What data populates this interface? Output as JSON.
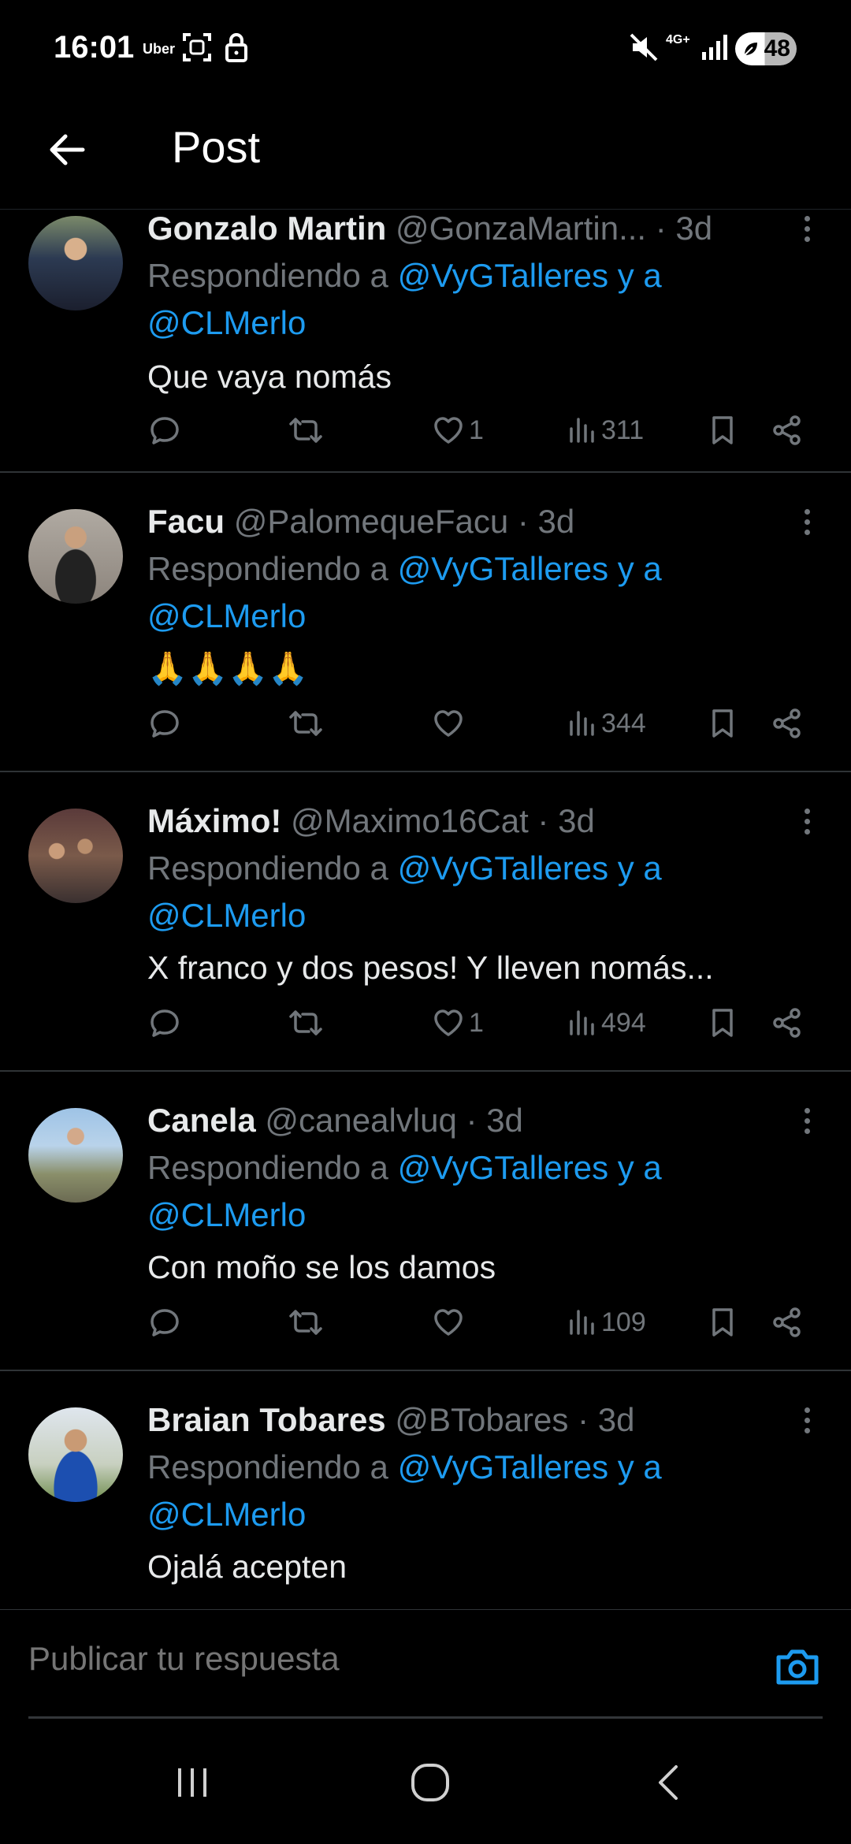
{
  "status": {
    "time": "16:01",
    "app": "Uber",
    "network": "4G+",
    "battery": "48"
  },
  "header": {
    "title": "Post"
  },
  "posts": [
    {
      "name": "Gonzalo Martin",
      "handle": "@GonzaMartin...",
      "dot": " · ",
      "time": "3d",
      "reply_prefix": "Respondiendo a ",
      "reply_links": "@VyGTalleres y a",
      "reply_link2": "@CLMerlo",
      "text": "Que vaya nomás",
      "likes": "1",
      "views": "311"
    },
    {
      "name": "Facu",
      "handle": "@PalomequeFacu",
      "dot": " · ",
      "time": "3d",
      "reply_prefix": "Respondiendo a ",
      "reply_links": "@VyGTalleres y a",
      "reply_link2": "@CLMerlo",
      "text": "🙏🙏🙏🙏",
      "likes": "",
      "views": "344"
    },
    {
      "name": "Máximo!",
      "handle": "@Maximo16Cat",
      "dot": " · ",
      "time": "3d",
      "reply_prefix": "Respondiendo a ",
      "reply_links": "@VyGTalleres y a",
      "reply_link2": "@CLMerlo",
      "text": "X franco y dos pesos! Y lleven nomás...",
      "likes": "1",
      "views": "494"
    },
    {
      "name": "Canela",
      "handle": "@canealvluq",
      "dot": " · ",
      "time": "3d",
      "reply_prefix": "Respondiendo a ",
      "reply_links": "@VyGTalleres y a",
      "reply_link2": "@CLMerlo",
      "text": "Con moño se los damos",
      "likes": "",
      "views": "109"
    },
    {
      "name": "Braian Tobares",
      "handle": "@BTobares",
      "dot": " · ",
      "time": "3d",
      "reply_prefix": "Respondiendo a ",
      "reply_links": "@VyGTalleres y a",
      "reply_link2": "@CLMerlo",
      "text": "Ojalá acepten",
      "likes": "",
      "views": ""
    }
  ],
  "compose": {
    "placeholder": "Publicar tu respuesta"
  },
  "colors": {
    "accent": "#1d9bf0",
    "muted": "#71767b",
    "text": "#e7e9ea",
    "background": "#000000"
  },
  "icons": {
    "header": "back-arrow-icon",
    "actions": [
      "reply-icon",
      "repost-icon",
      "like-icon",
      "views-icon",
      "bookmark-icon",
      "share-icon"
    ],
    "compose": "camera-icon",
    "nav": [
      "recents-icon",
      "home-icon",
      "back-icon"
    ]
  }
}
